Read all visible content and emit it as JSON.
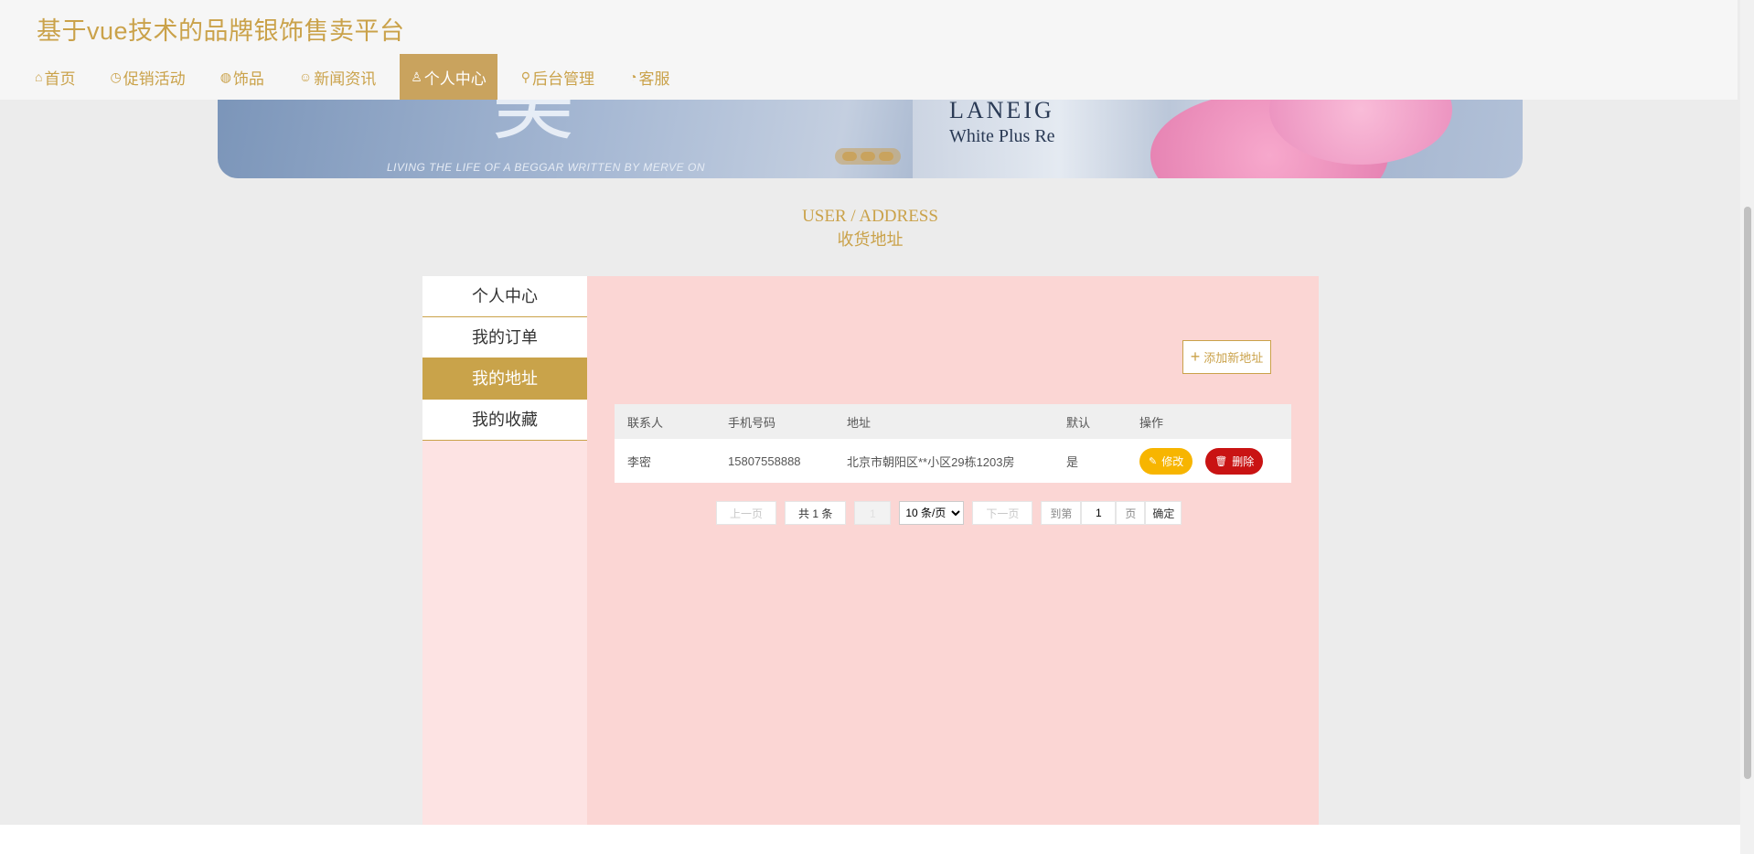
{
  "site_title": "基于vue技术的品牌银饰售卖平台",
  "nav": [
    {
      "icon": "home-icon",
      "glyph": "⌂",
      "label": "首页"
    },
    {
      "icon": "clock-icon",
      "glyph": "◷",
      "label": "促销活动"
    },
    {
      "icon": "globe-icon",
      "glyph": "◍",
      "label": "饰品"
    },
    {
      "icon": "news-icon",
      "glyph": "☺",
      "label": "新闻资讯"
    },
    {
      "icon": "user-icon",
      "glyph": "♙",
      "label": "个人中心",
      "active": true
    },
    {
      "icon": "link-icon",
      "glyph": "⚲",
      "label": "后台管理"
    },
    {
      "icon": "service-icon",
      "glyph": "◔",
      "label": "客服"
    }
  ],
  "banner": {
    "brand": "LANEIG",
    "brand_sub": "White Plus Re",
    "tagline": "LIVING THE LIFE OF A BEGGAR WRITTEN BY MERVE ON"
  },
  "section": {
    "title_en": "USER / ADDRESS",
    "title_cn": "收货地址"
  },
  "side_menu": [
    {
      "label": "个人中心",
      "active": false
    },
    {
      "label": "我的订单",
      "active": false
    },
    {
      "label": "我的地址",
      "active": true
    },
    {
      "label": "我的收藏",
      "active": false
    }
  ],
  "add_button": {
    "label": "添加新地址"
  },
  "table": {
    "headers": [
      "联系人",
      "手机号码",
      "地址",
      "默认",
      "操作"
    ],
    "rows": [
      {
        "contact": "李密",
        "phone": "15807558888",
        "address": "北京市朝阳区**小区29栋1203房",
        "default": "是",
        "edit_label": "修改",
        "delete_label": "删除"
      }
    ]
  },
  "pager": {
    "prev": "上一页",
    "total": "共 1 条",
    "current": "1",
    "page_size": "10 条/页",
    "next": "下一页",
    "goto": "到第",
    "goto_value": "1",
    "page_unit": "页",
    "confirm": "确定"
  },
  "colors": {
    "accent": "#caa24a",
    "panel": "#fbd6d4",
    "edit": "#f7b500",
    "delete": "#c91313"
  }
}
